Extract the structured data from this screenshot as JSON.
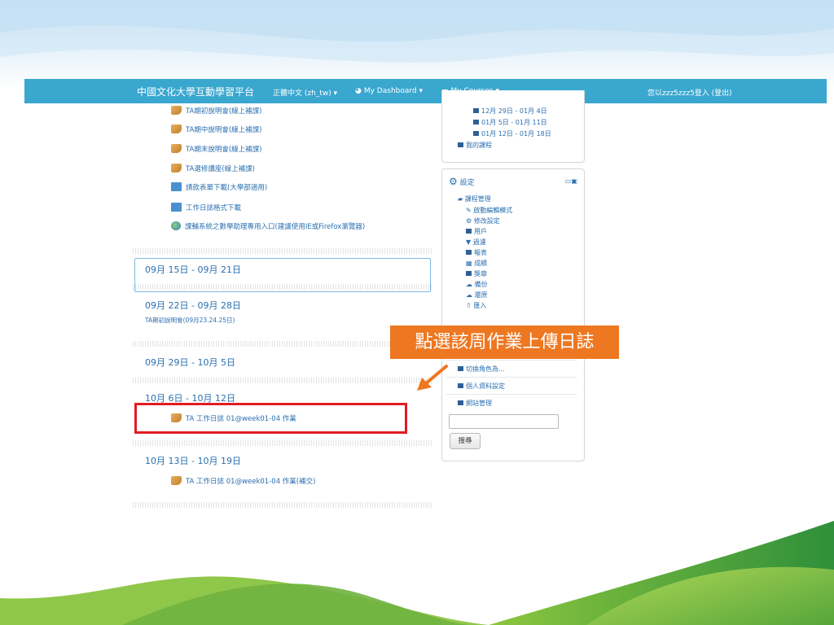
{
  "navbar": {
    "brand": "中國文化大學互動學習平台",
    "language": "正體中文 (zh_tw) ▾",
    "dashboard": "My Dashboard ▾",
    "courses": "My Courses ▾",
    "login_text": "您以zzz5zzz5登入 (登出)"
  },
  "main": {
    "top_items": [
      {
        "icon": "document-icon",
        "label": "TA期初說明會(線上補課)"
      },
      {
        "icon": "document-icon",
        "label": "TA期中說明會(線上補課)"
      },
      {
        "icon": "document-icon",
        "label": "TA期末說明會(線上補課)"
      },
      {
        "icon": "document-icon",
        "label": "TA選修講座(線上補課)"
      },
      {
        "icon": "folder-icon",
        "label": "請款表單下載(大學部適用)"
      },
      {
        "icon": "folder-icon",
        "label": "工作日誌格式下載"
      },
      {
        "icon": "globe-icon",
        "label": "課輔系統之數學助理專用入口(建議使用IE或Firefox瀏覽器)"
      }
    ],
    "sections": [
      {
        "title": "09月 15日 - 09月 21日"
      },
      {
        "title": "09月 22日 - 09月 28日",
        "summary": "TA期初說明會(09月23.24.25日)"
      },
      {
        "title": "09月 29日 - 10月 5日"
      },
      {
        "title": "10月 6日 - 10月 12日",
        "activity": "TA 工作日誌 01@week01-04 作業"
      },
      {
        "title": "10月 13日 - 10月 19日",
        "activity": "TA 工作日誌 01@week01-04 作業(補交)"
      }
    ]
  },
  "navigation_block": {
    "weeks": [
      "12月 29日 - 01月 4日",
      "01月 5日 - 01月 11日",
      "01月 12日 - 01月 18日"
    ],
    "my_courses": "我的課程"
  },
  "settings_block": {
    "title": "設定",
    "course_admin": "課程管理",
    "items": [
      "啟動編輯模式",
      "修改設定",
      "用戶",
      "過濾",
      "報表",
      "成績",
      "獎章",
      "備份",
      "還原",
      "匯入"
    ],
    "switch_role": "切換角色為...",
    "profile": "個人資料設定",
    "site_admin": "網站管理",
    "search_button": "搜尋"
  },
  "callout": {
    "text": "點選該周作業上傳日誌"
  },
  "colors": {
    "navbar": "#3aa7cf",
    "link": "#2a6fb0",
    "highlight_border": "#e21c23",
    "callout_bg": "#ee7721"
  }
}
